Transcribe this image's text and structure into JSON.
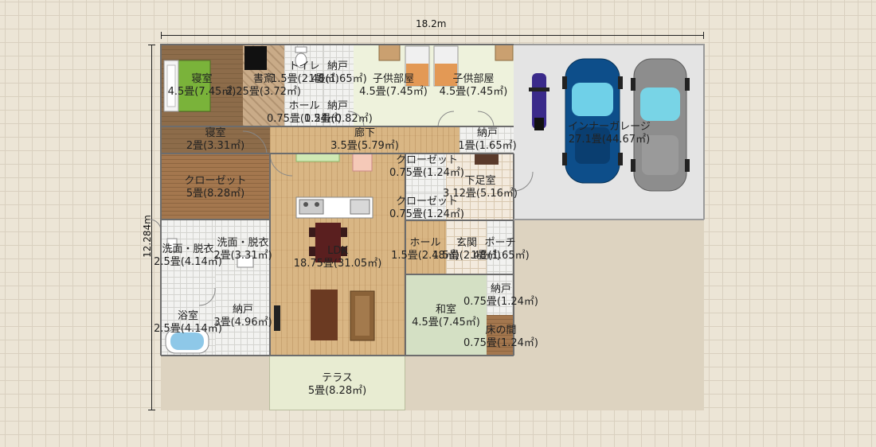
{
  "dimensions": {
    "width_label": "18.2m",
    "height_label": "12.284m"
  },
  "rooms": [
    {
      "key": "bedroom1",
      "name": "寝室",
      "area": "4.5畳(7.45㎡)"
    },
    {
      "key": "study",
      "name": "書斎",
      "area": "2.25畳(3.72㎡)"
    },
    {
      "key": "toilet",
      "name": "トイレ",
      "area": "1.5畳(2.48㎡)"
    },
    {
      "key": "storage1",
      "name": "納戸",
      "area": "1畳(1.65㎡)"
    },
    {
      "key": "kids1",
      "name": "子供部屋",
      "area": "4.5畳(7.45㎡)"
    },
    {
      "key": "kids2",
      "name": "子供部屋",
      "area": "4.5畳(7.45㎡)"
    },
    {
      "key": "hall1",
      "name": "ホール",
      "area": "0.75畳(1.24㎡)"
    },
    {
      "key": "storage2",
      "name": "納戸",
      "area": "0.5畳(0.82㎡)"
    },
    {
      "key": "bedroom2",
      "name": "寝室",
      "area": "2畳(3.31㎡)"
    },
    {
      "key": "corridor",
      "name": "廊下",
      "area": "3.5畳(5.79㎡)"
    },
    {
      "key": "storage3",
      "name": "納戸",
      "area": "1畳(1.65㎡)"
    },
    {
      "key": "garage",
      "name": "インナーガレージ",
      "area": "27.1畳(44.67㎡)"
    },
    {
      "key": "closet1",
      "name": "クローゼット",
      "area": "5畳(8.28㎡)"
    },
    {
      "key": "closet2",
      "name": "クローゼット",
      "area": "0.75畳(1.24㎡)"
    },
    {
      "key": "shoe",
      "name": "下足室",
      "area": "3.12畳(5.16㎡)"
    },
    {
      "key": "closet3",
      "name": "クローゼット",
      "area": "0.75畳(1.24㎡)"
    },
    {
      "key": "wash1",
      "name": "洗面・脱衣",
      "area": "2.5畳(4.14㎡)"
    },
    {
      "key": "wash2",
      "name": "洗面・脱衣",
      "area": "2畳(3.31㎡)"
    },
    {
      "key": "ldk",
      "name": "LDK",
      "area": "18.75畳(31.05㎡)"
    },
    {
      "key": "hall2",
      "name": "ホール",
      "area": "1.5畳(2.48㎡)"
    },
    {
      "key": "entrance",
      "name": "玄関",
      "area": "1.5畳(2.48㎡)"
    },
    {
      "key": "porch",
      "name": "ポーチ",
      "area": "1畳(1.65㎡)"
    },
    {
      "key": "storage4",
      "name": "納戸",
      "area": "0.75畳(1.24㎡)"
    },
    {
      "key": "bath",
      "name": "浴室",
      "area": "2.5畳(4.14㎡)"
    },
    {
      "key": "storage5",
      "name": "納戸",
      "area": "3畳(4.96㎡)"
    },
    {
      "key": "washitsu",
      "name": "和室",
      "area": "4.5畳(7.45㎡)"
    },
    {
      "key": "tokonoma",
      "name": "床の間",
      "area": "0.75畳(1.24㎡)"
    },
    {
      "key": "terrace",
      "name": "テラス",
      "area": "5畳(8.28㎡)"
    }
  ],
  "colors": {
    "background": "#ece5d6",
    "grid": "#d9d0bf",
    "wall": "#6d6d6d",
    "car_blue": "#0d4e8a",
    "car_gray": "#8d8d8d",
    "motorbike": "#3a2a8a"
  },
  "icons": [
    "bed-icon",
    "toilet-icon",
    "kitchen-icon",
    "dining-table-icon",
    "sofa-icon",
    "bathtub-icon",
    "car-icon",
    "motorbike-icon",
    "sink-icon"
  ]
}
